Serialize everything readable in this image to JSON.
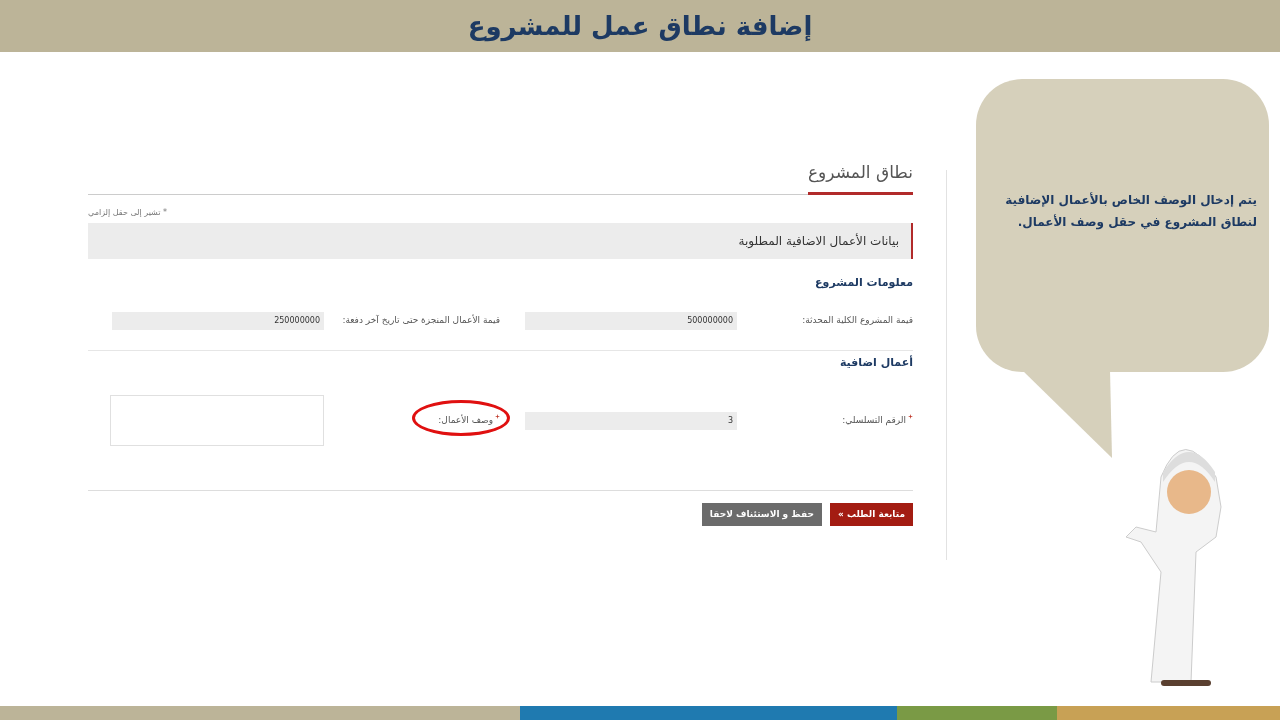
{
  "slide": {
    "title": "إضافة نطاق عمل للمشروع"
  },
  "form": {
    "page_title": "نطاق المشروع",
    "required_note": "* تشير إلى حقل إلزامي",
    "section_title": "بيانات الأعمال الاضافية المطلوبة",
    "groups": [
      {
        "heading": "معلومات المشروع",
        "fields": [
          {
            "kind": "input",
            "label": "قيمة المشروع الكلية المحدثة:",
            "value": "500000000",
            "required": false,
            "highlighted": false
          },
          {
            "kind": "input",
            "label": "قيمة الأعمال المنجزة حتى تاريخ آخر دفعة:",
            "value": "250000000",
            "required": false,
            "highlighted": false
          }
        ]
      },
      {
        "heading": "أعمال اضافية",
        "fields": [
          {
            "kind": "input",
            "label": "الرقم التسلسلي:",
            "value": "3",
            "required": true,
            "highlighted": false
          },
          {
            "kind": "textarea",
            "label": "وصف الأعمال:",
            "required": true,
            "highlighted": true
          }
        ]
      }
    ],
    "buttons": [
      {
        "kind": "primary",
        "label": "متابعة الطلب »"
      },
      {
        "kind": "secondary",
        "label": "حفظ و الاستئناف لاحقا"
      }
    ]
  },
  "callout": {
    "text": "يتم إدخال الوصف الخاص بالأعمال الإضافية لنطاق المشروع في حقل وصف الأعمال."
  }
}
